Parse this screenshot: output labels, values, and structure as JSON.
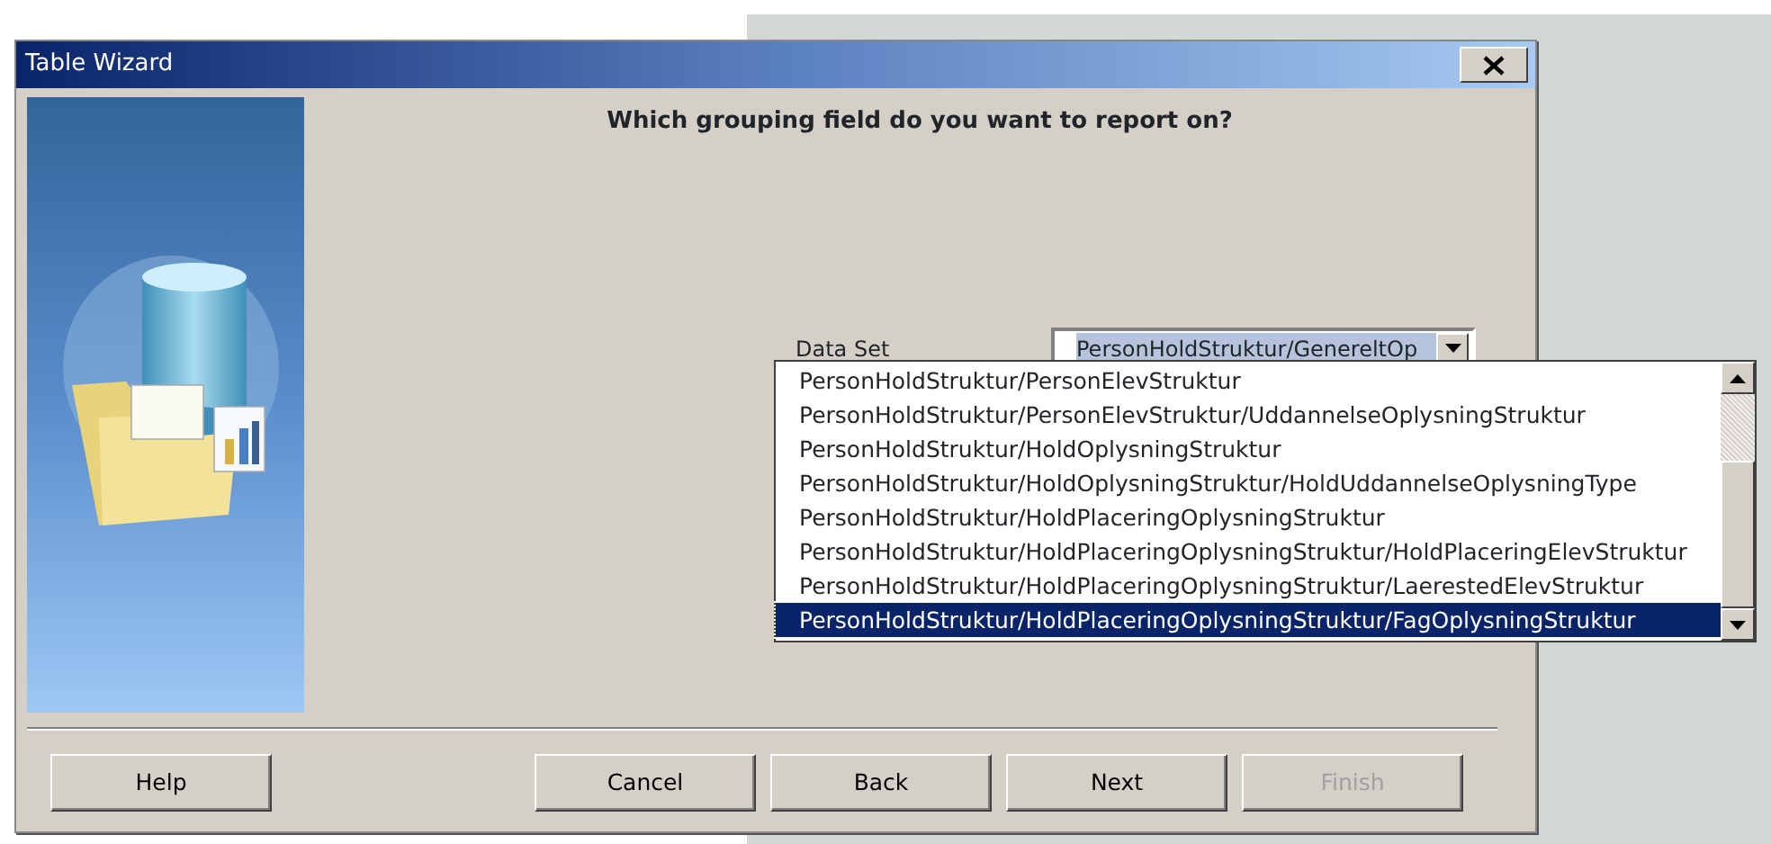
{
  "window": {
    "title": "Table Wizard"
  },
  "heading": "Which grouping field do you want to report on?",
  "data_set": {
    "label": "Data Set",
    "value": "PersonHoldStruktur/GenereltOp",
    "expanded": true
  },
  "dropdown_options": [
    {
      "label": "PersonHoldStruktur/PersonElevStruktur",
      "selected": false
    },
    {
      "label": "PersonHoldStruktur/PersonElevStruktur/UddannelseOplysningStruktur",
      "selected": false
    },
    {
      "label": "PersonHoldStruktur/HoldOplysningStruktur",
      "selected": false
    },
    {
      "label": "PersonHoldStruktur/HoldOplysningStruktur/HoldUddannelseOplysningType",
      "selected": false
    },
    {
      "label": "PersonHoldStruktur/HoldPlaceringOplysningStruktur",
      "selected": false
    },
    {
      "label": "PersonHoldStruktur/HoldPlaceringOplysningStruktur/HoldPlaceringElevStruktur",
      "selected": false
    },
    {
      "label": "PersonHoldStruktur/HoldPlaceringOplysningStruktur/LaerestedElevStruktur",
      "selected": false
    },
    {
      "label": "PersonHoldStruktur/HoldPlaceringOplysningStruktur/FagOplysningStruktur",
      "selected": true
    }
  ],
  "buttons": [
    {
      "label": "Help",
      "disabled": false
    },
    {
      "label": "Cancel",
      "disabled": false
    },
    {
      "label": "Back",
      "disabled": false
    },
    {
      "label": "Next",
      "disabled": false
    },
    {
      "label": "Finish",
      "disabled": true
    }
  ]
}
